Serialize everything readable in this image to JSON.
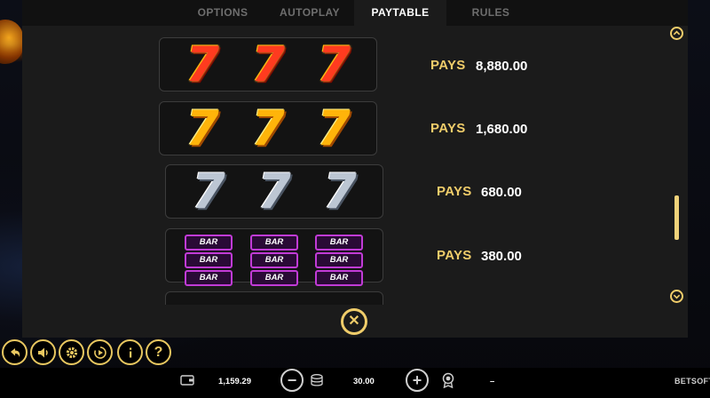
{
  "tabs": [
    {
      "label": "OPTIONS",
      "active": false
    },
    {
      "label": "AUTOPLAY",
      "active": false
    },
    {
      "label": "PAYTABLE",
      "active": true
    },
    {
      "label": "RULES",
      "active": false
    }
  ],
  "paytable": [
    {
      "symbol": "fire-seven",
      "pays_label": "PAYS",
      "amount": "8,880.00"
    },
    {
      "symbol": "gold-seven",
      "pays_label": "PAYS",
      "amount": "1,680.00"
    },
    {
      "symbol": "silver-seven",
      "pays_label": "PAYS",
      "amount": "680.00"
    },
    {
      "symbol": "triple-bar",
      "pays_label": "PAYS",
      "amount": "380.00"
    }
  ],
  "seven_glyph": "7",
  "bar_label": "BAR",
  "scroll": {
    "position_fraction": 0.55
  },
  "status": {
    "balance": "1,159.29",
    "bet": "30.00",
    "win": "–"
  },
  "logo": {
    "text": "BETSOFT"
  },
  "colors": {
    "accent": "#f0cd6a",
    "panel": "#1b1b1b",
    "fire": "#ff3b1f",
    "gold": "#ffb40a",
    "silver": "#bcc6d3",
    "bar_border": "#c13bd6"
  },
  "icons": {
    "controls": [
      "back-arrow-icon",
      "sound-icon",
      "settings-gear-icon",
      "autoplay-icon",
      "info-icon",
      "help-question-icon"
    ],
    "scroll_up": "chevron-up-icon",
    "scroll_down": "chevron-down-icon",
    "close": "close-x-icon",
    "wallet": "wallet-icon",
    "coins": "coin-stack-icon",
    "win": "trophy-icon"
  }
}
